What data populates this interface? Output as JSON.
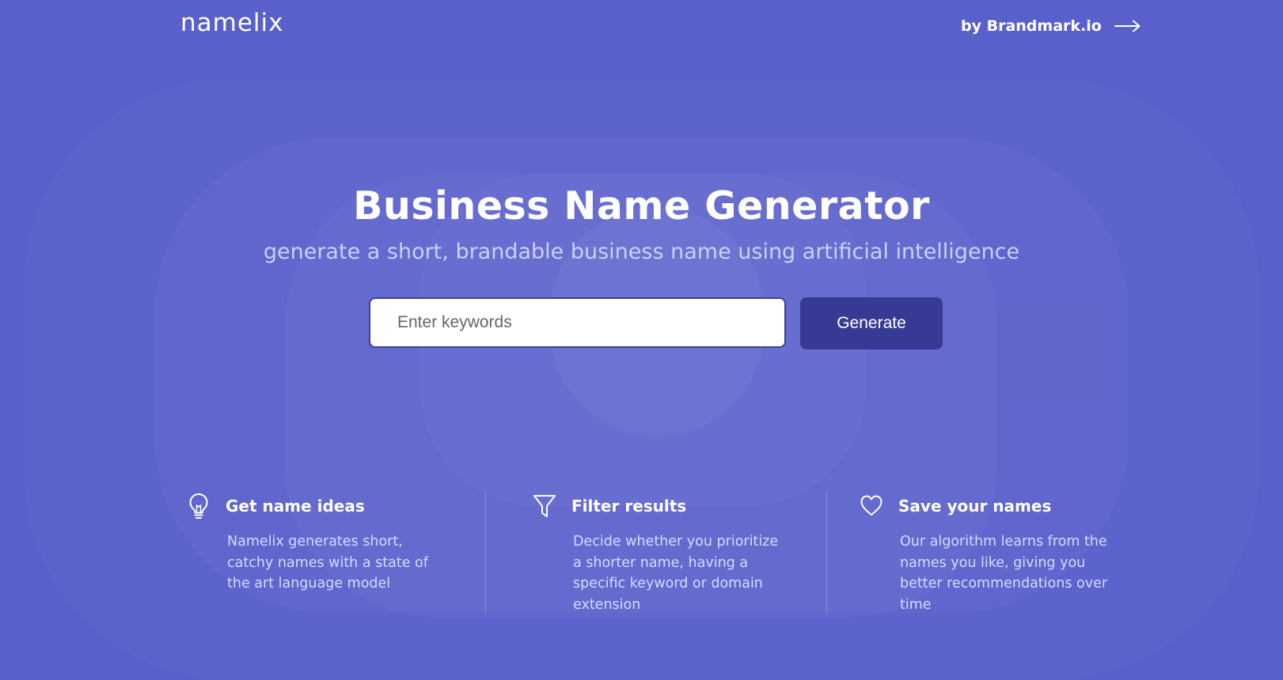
{
  "header": {
    "logo": "namelix",
    "brand_link": "by Brandmark.io"
  },
  "hero": {
    "title": "Business Name Generator",
    "subtitle": "generate a short, brandable business name using artificial intelligence"
  },
  "search": {
    "placeholder": "Enter keywords",
    "value": "",
    "button_label": "Generate"
  },
  "features": [
    {
      "icon": "lightbulb-icon",
      "title": "Get name ideas",
      "description": "Namelix generates short, catchy names with a state of the art language model"
    },
    {
      "icon": "filter-icon",
      "title": "Filter results",
      "description": "Decide whether you prioritize a shorter name, having a specific keyword or domain extension"
    },
    {
      "icon": "heart-icon",
      "title": "Save your names",
      "description": "Our algorithm learns from the names you like, giving you better recommendations over time"
    }
  ],
  "colors": {
    "background": "#5a60cb",
    "button": "#363a94",
    "subtitle": "#c9d1f8"
  }
}
